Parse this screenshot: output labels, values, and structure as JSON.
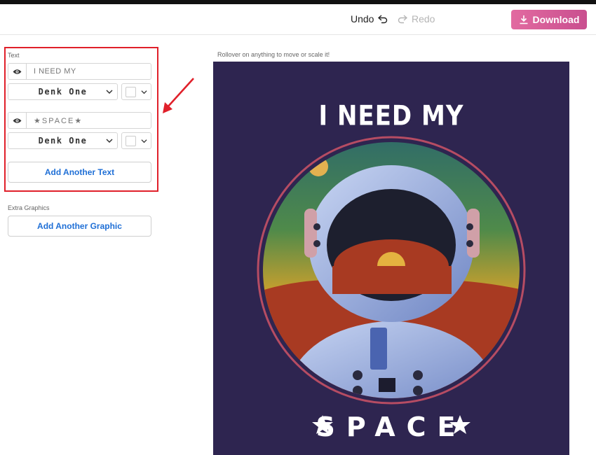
{
  "toolbar": {
    "undo_label": "Undo",
    "redo_label": "Redo",
    "download_label": "Download",
    "download_color": "#d65a9a"
  },
  "sidebar": {
    "text_section_label": "Text",
    "texts": [
      {
        "value": "I NEED MY",
        "font": "Denk One"
      },
      {
        "value": "★SPACE★",
        "font": "Denk One"
      }
    ],
    "add_text_label": "Add Another Text",
    "graphics_section_label": "Extra Graphics",
    "add_graphic_label": "Add Another Graphic"
  },
  "canvas": {
    "hint": "Rollover on anything to move or scale it!",
    "background_color": "#2e2550",
    "line1": "I NEED MY",
    "line2": "SPACE"
  },
  "annotation": {
    "highlight_color": "#e0202a"
  }
}
